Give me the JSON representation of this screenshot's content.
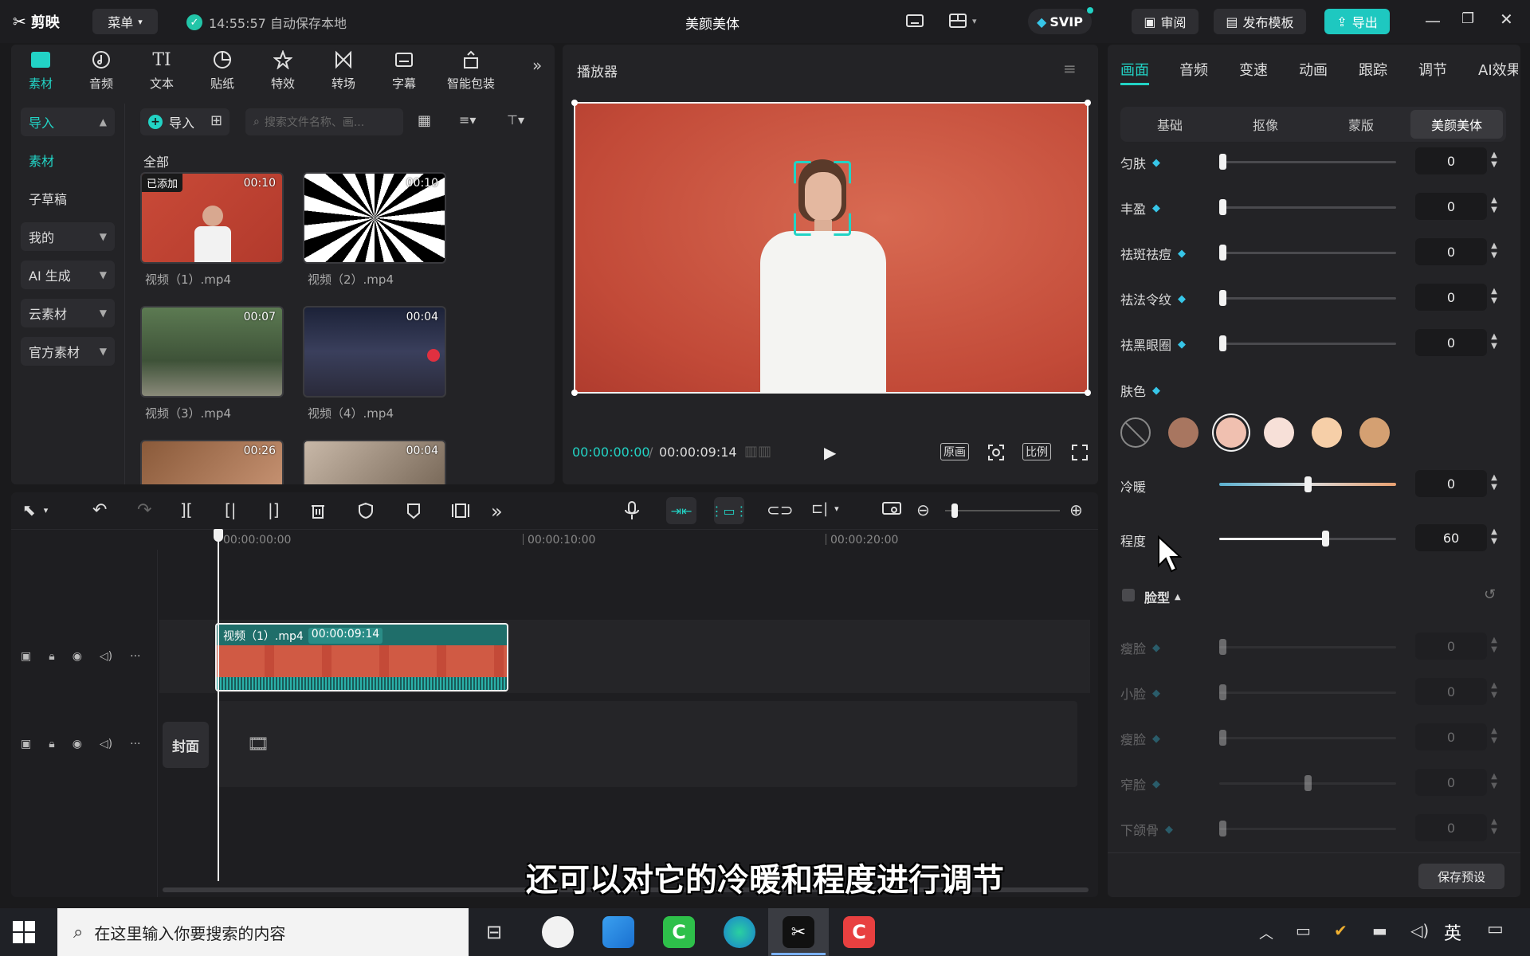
{
  "titlebar": {
    "app_name": "剪映",
    "menu_label": "菜单",
    "autosave_text": "14:55:57 自动保存本地",
    "project_title": "美颜美体",
    "svip_label": "SVIP",
    "review_label": "审阅",
    "publish_label": "发布模板",
    "export_label": "导出"
  },
  "media_panel": {
    "tools": [
      "素材",
      "音频",
      "文本",
      "贴纸",
      "特效",
      "转场",
      "字幕",
      "智能包装"
    ],
    "side_items": [
      "导入",
      "素材",
      "子草稿",
      "我的",
      "AI 生成",
      "云素材",
      "官方素材"
    ],
    "import_label": "导入",
    "search_placeholder": "搜索文件名称、画...",
    "section_all": "全部",
    "clips": [
      {
        "name": "视频（1）.mp4",
        "duration": "00:10",
        "badge": "已添加"
      },
      {
        "name": "视频（2）.mp4",
        "duration": "00:10"
      },
      {
        "name": "视频（3）.mp4",
        "duration": "00:07"
      },
      {
        "name": "视频（4）.mp4",
        "duration": "00:04"
      },
      {
        "name": "",
        "duration": "00:26"
      },
      {
        "name": "",
        "duration": "00:04"
      }
    ]
  },
  "player": {
    "title": "播放器",
    "current_time": "00:00:00:00",
    "total_time": "00:00:09:14",
    "original_label": "原画",
    "ratio_label": "比例"
  },
  "right_panel": {
    "tabs": [
      "画面",
      "音频",
      "变速",
      "动画",
      "跟踪",
      "调节",
      "AI效果"
    ],
    "subtabs": [
      "基础",
      "抠像",
      "蒙版",
      "美颜美体"
    ],
    "sliders_top": [
      {
        "label": "匀肤",
        "value": "0",
        "level": 0
      },
      {
        "label": "丰盈",
        "value": "0",
        "level": 0
      },
      {
        "label": "祛斑祛痘",
        "value": "0",
        "level": 0
      },
      {
        "label": "祛法令纹",
        "value": "0",
        "level": 0
      },
      {
        "label": "祛黑眼圈",
        "value": "0",
        "level": 0
      }
    ],
    "skin_tone_label": "肤色",
    "skin_colors": [
      "#a87660",
      "#f0c0b0",
      "#f7e0d8",
      "#f6cfa8",
      "#d4a072"
    ],
    "warm_label": "冷暖",
    "warm_value": "0",
    "degree_label": "程度",
    "degree_value": "60",
    "face_shape_label": "脸型",
    "sliders_face": [
      {
        "label": "瘦脸",
        "value": "0",
        "level": 0
      },
      {
        "label": "小脸",
        "value": "0",
        "level": 0
      },
      {
        "label": "瘦脸",
        "value": "0",
        "level": 0
      },
      {
        "label": "窄脸",
        "value": "0",
        "level": 0.5
      },
      {
        "label": "下颌骨",
        "value": "0",
        "level": 0
      }
    ],
    "save_preset_label": "保存预设"
  },
  "timeline": {
    "ruler": [
      "00:00:00:00",
      "00:00:10:00",
      "00:00:20:00"
    ],
    "clip_name": "视频（1）.mp4",
    "clip_duration": "00:00:09:14",
    "cover_label": "封面"
  },
  "subtitle_caption": "还可以对它的冷暖和程度进行调节",
  "taskbar": {
    "search_placeholder": "在这里输入你要搜索的内容",
    "ime_label": "英"
  }
}
